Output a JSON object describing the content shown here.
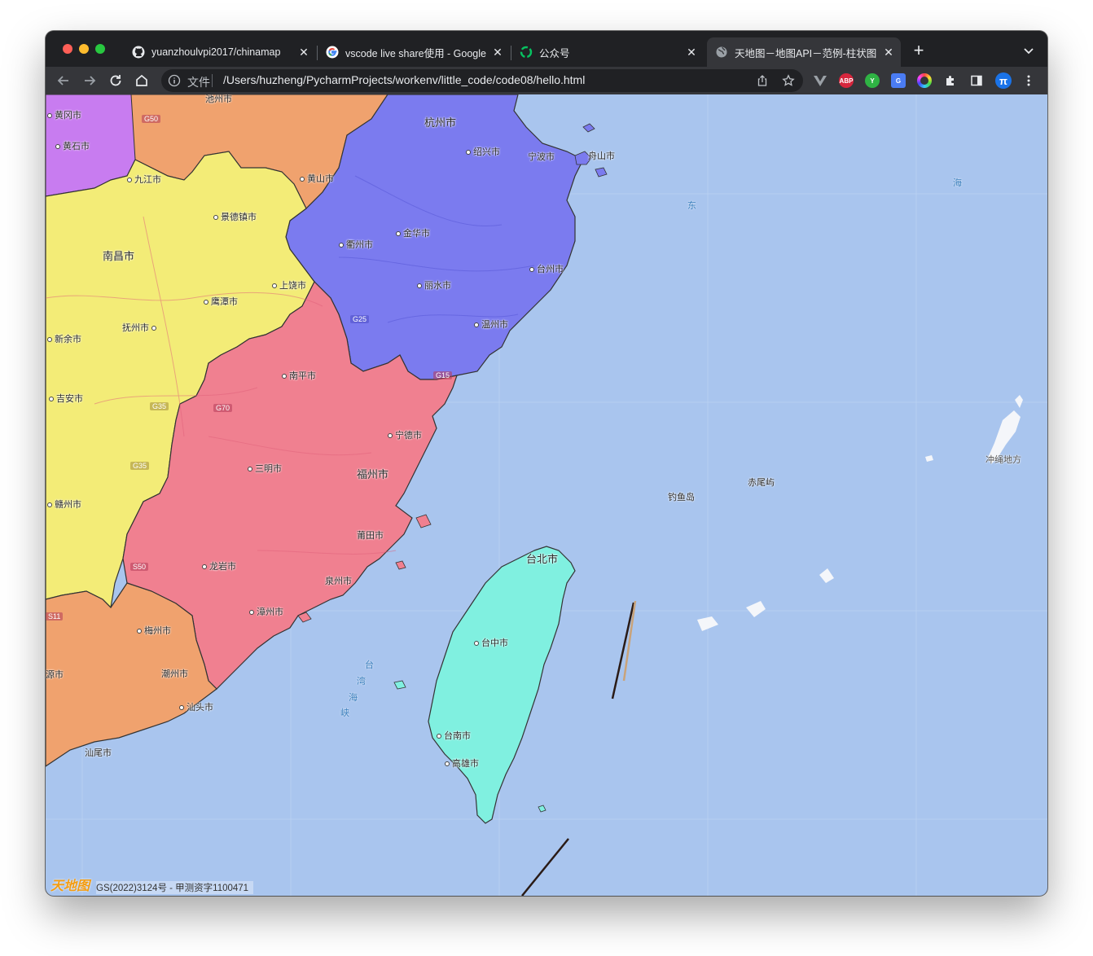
{
  "browser": {
    "tabs": [
      {
        "title": "yuanzhoulvpi2017/chinamap",
        "icon": "github-icon",
        "active": false
      },
      {
        "title": "vscode live share使用 - Google",
        "icon": "google-icon",
        "active": false
      },
      {
        "title": "公众号",
        "icon": "wechat-icon",
        "active": false
      },
      {
        "title": "天地图－地图API－范例-柱状图",
        "icon": "globe-icon",
        "active": true
      }
    ],
    "address": {
      "scheme_label": "文件",
      "url": "/Users/huzheng/PycharmProjects/workenv/little_code/code08/hello.html"
    },
    "extensions": [
      "vue-devtools-icon",
      "adblock-icon",
      "yandex-icon",
      "translate-icon",
      "color-picker-icon",
      "puzzle-icon",
      "sidebar-icon",
      "profile-icon"
    ],
    "extension_labels": {
      "adblock": "ABP",
      "yandex": "Y",
      "translate": "G",
      "profile": "π"
    }
  },
  "map": {
    "colors": {
      "sea": "#a9c5ee",
      "zhejiang": "#7b7bef",
      "fujian": "#f08090",
      "jiangxi": "#f3ec77",
      "taiwan": "#80f0e0",
      "guangdong": "#f0a26e",
      "anhui": "#f0a26e",
      "hubei": "#c87cf0"
    },
    "cities": [
      {
        "name": "杭州市",
        "big": true
      },
      {
        "name": "绍兴市"
      },
      {
        "name": "宁波市"
      },
      {
        "name": "舟山市"
      },
      {
        "name": "黄山市"
      },
      {
        "name": "池州市"
      },
      {
        "name": "黄冈市"
      },
      {
        "name": "黄石市"
      },
      {
        "name": "九江市"
      },
      {
        "name": "景德镇市"
      },
      {
        "name": "南昌市",
        "big": true
      },
      {
        "name": "金华市"
      },
      {
        "name": "衢州市"
      },
      {
        "name": "台州市"
      },
      {
        "name": "丽水市"
      },
      {
        "name": "上饶市"
      },
      {
        "name": "鹰潭市"
      },
      {
        "name": "抚州市"
      },
      {
        "name": "新余市"
      },
      {
        "name": "温州市"
      },
      {
        "name": "南平市"
      },
      {
        "name": "吉安市"
      },
      {
        "name": "宁德市"
      },
      {
        "name": "三明市"
      },
      {
        "name": "福州市",
        "big": true
      },
      {
        "name": "赣州市"
      },
      {
        "name": "莆田市"
      },
      {
        "name": "龙岩市"
      },
      {
        "name": "泉州市"
      },
      {
        "name": "漳州市"
      },
      {
        "name": "梅州市"
      },
      {
        "name": "潮州市"
      },
      {
        "name": "汕头市"
      },
      {
        "name": "汕尾市"
      },
      {
        "name": "源市"
      },
      {
        "name": "台北市",
        "big": true
      },
      {
        "name": "台中市"
      },
      {
        "name": "台南市"
      },
      {
        "name": "高雄市"
      },
      {
        "name": "钓鱼岛"
      },
      {
        "name": "赤尾屿"
      },
      {
        "name": "冲绳地方"
      }
    ],
    "sea_labels": [
      "东",
      "海",
      "台",
      "湾",
      "海",
      "峡"
    ],
    "highways": [
      "G50",
      "G25",
      "G15",
      "G35",
      "G70",
      "G35",
      "S50",
      "S11"
    ],
    "logo_text": "天地图",
    "copyright": "GS(2022)3124号 - 甲测资字1100471"
  }
}
